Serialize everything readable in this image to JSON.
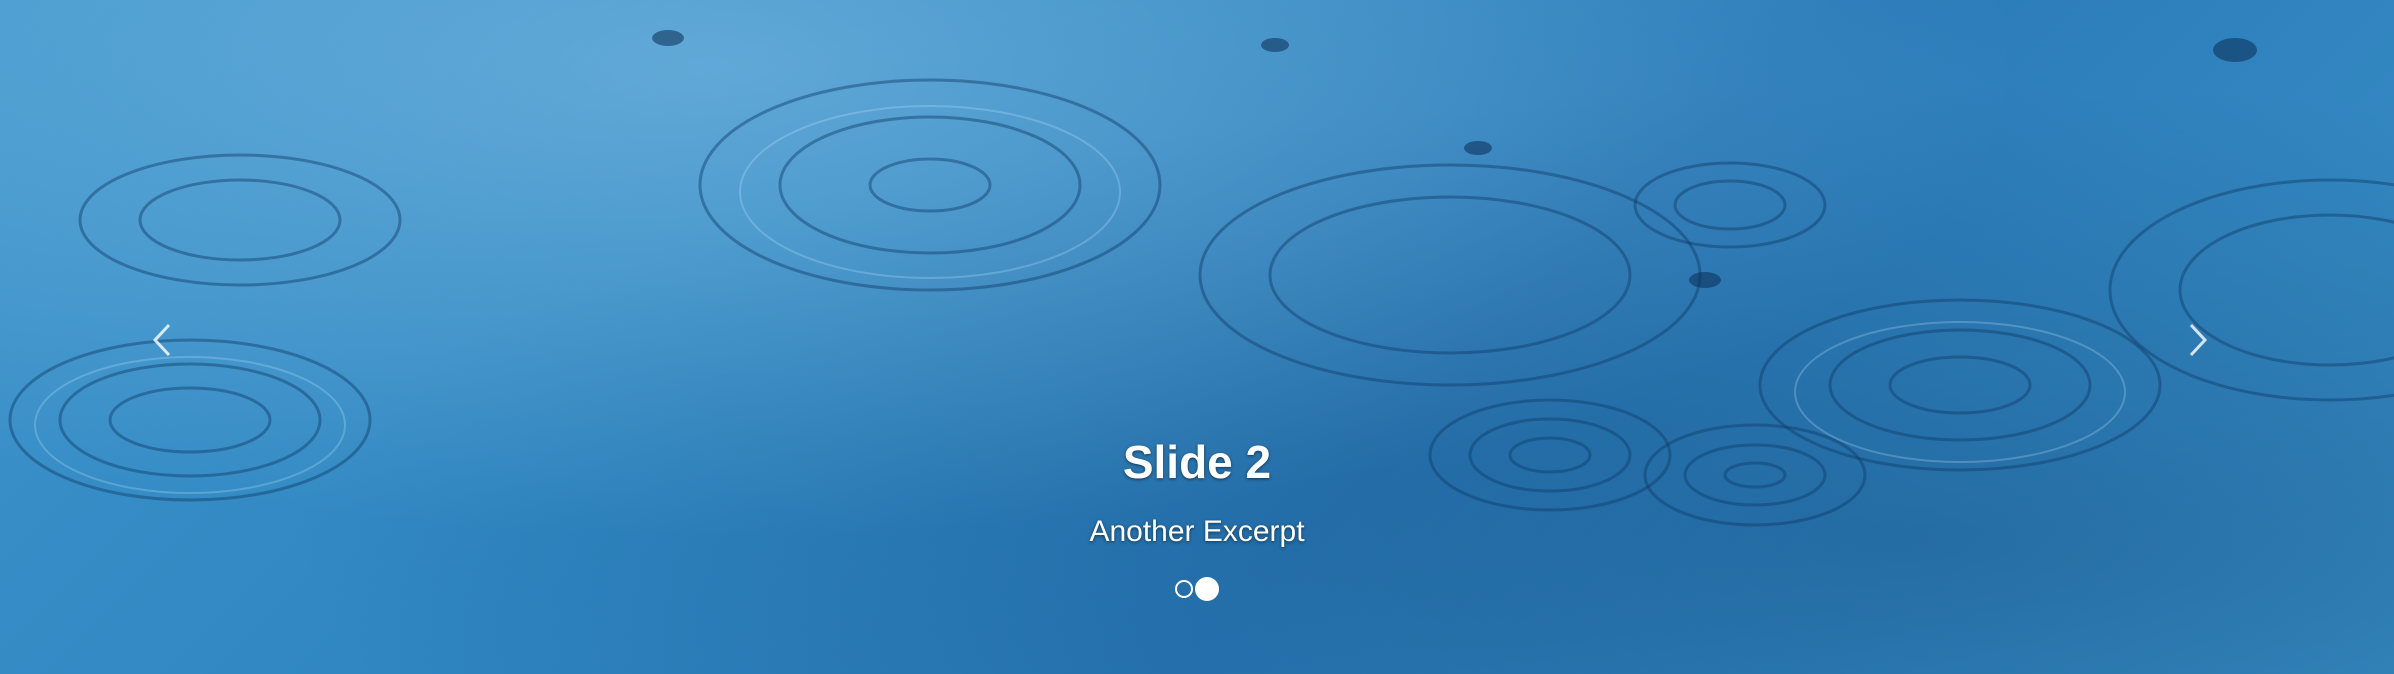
{
  "slide": {
    "title": "Slide 2",
    "excerpt": "Another Excerpt"
  },
  "controls": {
    "prev_icon": "chevron-left-icon",
    "next_icon": "chevron-right-icon"
  },
  "indicators": {
    "count": 2,
    "active_index": 1
  },
  "colors": {
    "water": "#2f86c1",
    "text": "#ffffff"
  }
}
